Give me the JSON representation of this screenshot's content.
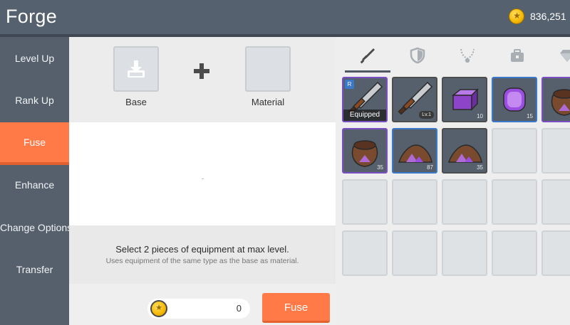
{
  "header": {
    "title": "Forge",
    "currency_amount": "836,251",
    "currency_icon": "gold-coin-icon"
  },
  "sidebar": {
    "items": [
      {
        "label": "Level Up",
        "active": false
      },
      {
        "label": "Rank Up",
        "active": false
      },
      {
        "label": "Fuse",
        "active": true
      },
      {
        "label": "Enhance",
        "active": false
      },
      {
        "label": "Change Options",
        "active": false
      },
      {
        "label": "Transfer",
        "active": false
      }
    ]
  },
  "fuse_panel": {
    "base_label": "Base",
    "material_label": "Material",
    "preview_placeholder": "-",
    "instruction": "Select 2 pieces of equipment at max level.",
    "sub_instruction": "Uses equipment of the same type as the base as material.",
    "cost_value": "0",
    "fuse_button_label": "Fuse"
  },
  "inventory": {
    "tabs": [
      {
        "icon": "sword-icon",
        "active": true
      },
      {
        "icon": "shield-icon",
        "active": false
      },
      {
        "icon": "necklace-icon",
        "active": false
      },
      {
        "icon": "chest-icon",
        "active": false
      },
      {
        "icon": "gem-icon",
        "active": false
      }
    ],
    "items": [
      {
        "icon": "sword-icon",
        "rank": "R",
        "tag": "Equipped"
      },
      {
        "icon": "sword-icon",
        "level": "Lv.1"
      },
      {
        "icon": "purple-ingot-icon",
        "quantity": "10"
      },
      {
        "icon": "purple-gem-icon",
        "quantity": "15"
      },
      {
        "icon": "ore-bag-icon",
        "quantity": ""
      },
      {
        "icon": "ore-bag-icon",
        "quantity": "35"
      },
      {
        "icon": "ore-pile-icon",
        "quantity": "87"
      },
      {
        "icon": "ore-pile-icon",
        "quantity": "35"
      }
    ]
  },
  "colors": {
    "header": "#55616e",
    "sidebar": "#55606c",
    "accent": "#ff7a47",
    "rare_border": "#7a4fc3",
    "blue_border": "#3a78c9"
  }
}
